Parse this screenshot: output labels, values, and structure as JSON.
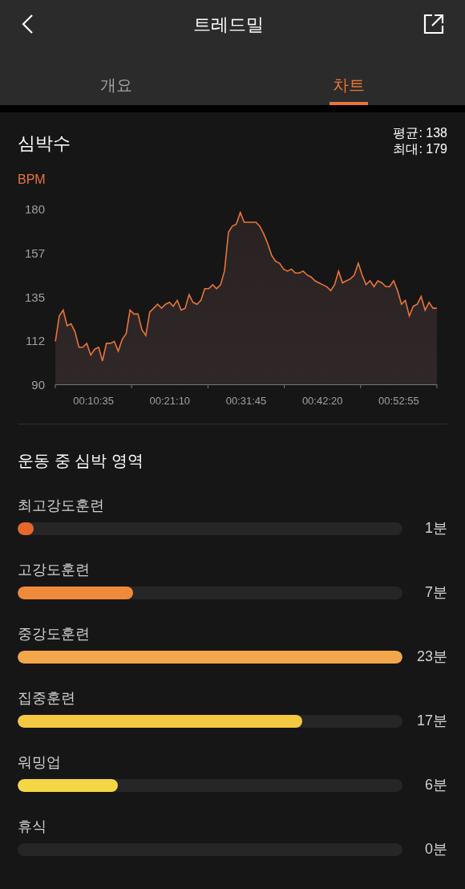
{
  "header": {
    "title": "트레드밀"
  },
  "tabs": [
    {
      "label": "개요",
      "selected": false
    },
    {
      "label": "차트",
      "selected": true
    }
  ],
  "heart_rate": {
    "title": "심박수",
    "average": "평균: 138",
    "max": "최대: 179",
    "chart_data": {
      "type": "area",
      "ylabel": "BPM",
      "ylim": [
        90,
        180
      ],
      "yticks": [
        {
          "value": 90,
          "label": "90"
        },
        {
          "value": 112.5,
          "label": "112"
        },
        {
          "value": 135,
          "label": "135"
        },
        {
          "value": 157.5,
          "label": "157"
        },
        {
          "value": 180,
          "label": "180"
        }
      ],
      "xlim": [
        317.5,
        3492.5
      ],
      "x": [
        318,
        350,
        383,
        416,
        448,
        481,
        514,
        547,
        579,
        612,
        645,
        678,
        710,
        743,
        776,
        808,
        841,
        874,
        907,
        939,
        972,
        1005,
        1038,
        1070,
        1103,
        1136,
        1168,
        1201,
        1234,
        1267,
        1299,
        1332,
        1365,
        1398,
        1430,
        1463,
        1496,
        1529,
        1561,
        1594,
        1627,
        1659,
        1692,
        1725,
        1758,
        1790,
        1823,
        1856,
        1889,
        1921,
        1954,
        1987,
        2019,
        2052,
        2085,
        2118,
        2150,
        2183,
        2216,
        2249,
        2281,
        2314,
        2347,
        2379,
        2412,
        2445,
        2478,
        2510,
        2543,
        2576,
        2609,
        2641,
        2674,
        2707,
        2739,
        2772,
        2805,
        2838,
        2870,
        2903,
        2936,
        2969,
        3001,
        3034,
        3067,
        3099,
        3132,
        3165,
        3198,
        3230,
        3263,
        3296,
        3329,
        3361,
        3394,
        3427,
        3460,
        3492
      ],
      "xticks": [
        {
          "value": 635,
          "label": "00:10:35"
        },
        {
          "value": 1270,
          "label": "00:21:10"
        },
        {
          "value": 1905,
          "label": "00:31:45"
        },
        {
          "value": 2540,
          "label": "00:42:20"
        },
        {
          "value": 3175,
          "label": "00:52:55"
        }
      ],
      "series": [
        {
          "color": "#e8743a",
          "values": [
            112,
            125,
            128,
            120,
            121,
            117,
            109,
            109,
            111,
            105,
            108,
            109,
            102,
            111,
            111,
            112,
            107,
            113,
            116,
            128,
            126,
            126,
            118,
            115,
            127,
            129,
            131,
            129,
            131,
            132,
            130,
            133,
            128,
            129,
            136,
            132,
            131,
            133,
            139,
            139,
            141,
            139,
            141,
            148,
            168,
            171,
            172,
            178,
            173,
            173,
            173,
            173,
            171,
            167,
            162,
            156,
            153,
            152,
            149,
            148,
            149,
            147,
            147,
            148,
            146,
            145,
            143,
            142,
            141,
            140,
            138,
            141,
            148,
            142,
            143,
            144,
            146,
            152,
            146,
            141,
            143,
            140,
            143,
            142,
            140,
            140,
            143,
            138,
            131,
            133,
            125,
            130,
            131,
            135,
            128,
            132,
            129,
            129
          ]
        }
      ]
    }
  },
  "zones": {
    "title": "운동 중 심박 영역",
    "items": [
      {
        "name": "최고강도훈련",
        "level": 0.04,
        "color": "#e8672c",
        "duration": "1분"
      },
      {
        "name": "고강도훈련",
        "level": 0.3,
        "color": "#ef8a3a",
        "duration": "7분"
      },
      {
        "name": "중강도훈련",
        "level": 1,
        "color": "#f4a64a",
        "duration": "23분"
      },
      {
        "name": "집중훈련",
        "level": 0.74,
        "color": "#f5c842",
        "duration": "17분"
      },
      {
        "name": "워밍업",
        "level": 0.26,
        "color": "#f5d745",
        "duration": "6분"
      },
      {
        "name": "휴식",
        "duration": "0분"
      }
    ]
  }
}
